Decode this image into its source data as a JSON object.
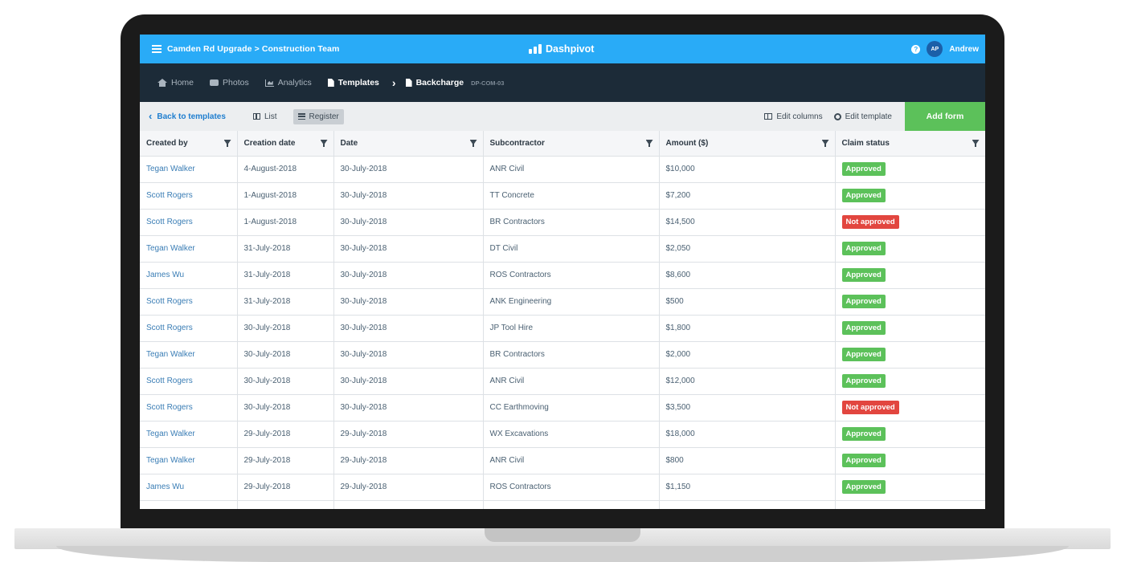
{
  "header": {
    "breadcrumb": "Camden Rd Upgrade > Construction Team",
    "logo_text": "Dashpivot",
    "help_label": "?",
    "avatar_initials": "AP",
    "user_name": "Andrew"
  },
  "nav": {
    "home": "Home",
    "photos": "Photos",
    "analytics": "Analytics",
    "templates": "Templates",
    "current": "Backcharge",
    "current_code": "DP-COM-03"
  },
  "toolbar": {
    "back_label": "Back to templates",
    "list_label": "List",
    "register_label": "Register",
    "edit_columns_label": "Edit columns",
    "edit_template_label": "Edit template",
    "add_form_label": "Add form"
  },
  "table": {
    "columns": [
      "Created by",
      "Creation date",
      "Date",
      "Subcontractor",
      "Amount ($)",
      "Claim status"
    ],
    "rows": [
      {
        "created_by": "Tegan Walker",
        "creation_date": "4-August-2018",
        "date": "30-July-2018",
        "subcontractor": "ANR Civil",
        "amount": "$10,000",
        "status": "Approved"
      },
      {
        "created_by": "Scott Rogers",
        "creation_date": "1-August-2018",
        "date": "30-July-2018",
        "subcontractor": "TT Concrete",
        "amount": "$7,200",
        "status": "Approved"
      },
      {
        "created_by": "Scott Rogers",
        "creation_date": "1-August-2018",
        "date": "30-July-2018",
        "subcontractor": "BR Contractors",
        "amount": "$14,500",
        "status": "Not approved"
      },
      {
        "created_by": "Tegan Walker",
        "creation_date": "31-July-2018",
        "date": "30-July-2018",
        "subcontractor": "DT Civil",
        "amount": "$2,050",
        "status": "Approved"
      },
      {
        "created_by": "James Wu",
        "creation_date": "31-July-2018",
        "date": "30-July-2018",
        "subcontractor": "ROS Contractors",
        "amount": "$8,600",
        "status": "Approved"
      },
      {
        "created_by": "Scott Rogers",
        "creation_date": "31-July-2018",
        "date": "30-July-2018",
        "subcontractor": "ANK Engineering",
        "amount": "$500",
        "status": "Approved"
      },
      {
        "created_by": "Scott Rogers",
        "creation_date": "30-July-2018",
        "date": "30-July-2018",
        "subcontractor": "JP Tool Hire",
        "amount": "$1,800",
        "status": "Approved"
      },
      {
        "created_by": "Tegan Walker",
        "creation_date": "30-July-2018",
        "date": "30-July-2018",
        "subcontractor": "BR Contractors",
        "amount": "$2,000",
        "status": "Approved"
      },
      {
        "created_by": "Scott Rogers",
        "creation_date": "30-July-2018",
        "date": "30-July-2018",
        "subcontractor": "ANR Civil",
        "amount": "$12,000",
        "status": "Approved"
      },
      {
        "created_by": "Scott Rogers",
        "creation_date": "30-July-2018",
        "date": "30-July-2018",
        "subcontractor": "CC Earthmoving",
        "amount": "$3,500",
        "status": "Not approved"
      },
      {
        "created_by": "Tegan Walker",
        "creation_date": "29-July-2018",
        "date": "29-July-2018",
        "subcontractor": "WX Excavations",
        "amount": "$18,000",
        "status": "Approved"
      },
      {
        "created_by": "Tegan Walker",
        "creation_date": "29-July-2018",
        "date": "29-July-2018",
        "subcontractor": "ANR Civil",
        "amount": "$800",
        "status": "Approved"
      },
      {
        "created_by": "James Wu",
        "creation_date": "29-July-2018",
        "date": "29-July-2018",
        "subcontractor": "ROS Contractors",
        "amount": "$1,150",
        "status": "Approved"
      }
    ]
  },
  "colors": {
    "brand_blue": "#29abf7",
    "nav_dark": "#1c2b38",
    "approved_green": "#5cc15a",
    "not_approved_red": "#e2463f"
  }
}
